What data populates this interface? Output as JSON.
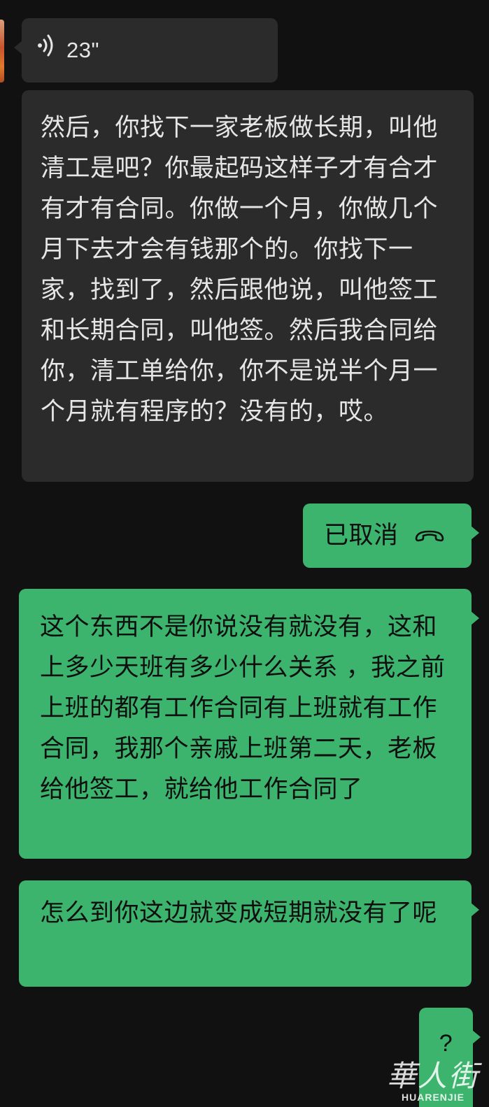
{
  "voice_message": {
    "duration": "23\"",
    "icon": "voice-wave-icon"
  },
  "transcript": {
    "text": "然后，你找下一家老板做长期，叫他清工是吧？你最起码这样子才有合才有才有合同。你做一个月，你做几个月下去才会有钱那个的。你找下一家，找到了，然后跟他说，叫他签工和长期合同，叫他签。然后我合同给你，清工单给你，你不是说半个月一个月就有程序的？没有的，哎。"
  },
  "call_status": {
    "label": "已取消",
    "icon": "phone-hangup-icon"
  },
  "messages": [
    {
      "text": "这个东西不是你说没有就没有，这和上多少天班有多少什么关系 ，我之前上班的都有工作合同有上班就有工作合同，我那个亲戚上班第二天，老板给他签工，就给他工作合同了"
    },
    {
      "text": "怎么到你这边就变成短期就没有了呢"
    },
    {
      "text": "?"
    }
  ],
  "watermark": {
    "logo_text": "華人街",
    "subtitle": "HUARENJIE"
  },
  "colors": {
    "background": "#111111",
    "incoming_bubble": "#2b2b2b",
    "outgoing_bubble": "#3cb46e"
  }
}
